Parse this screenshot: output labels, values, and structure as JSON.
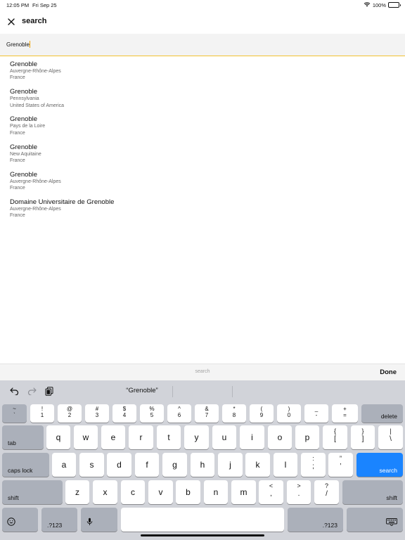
{
  "status_bar": {
    "time": "12:05 PM",
    "date": "Fri Sep 25",
    "battery": "100%"
  },
  "nav": {
    "title": "search"
  },
  "search": {
    "value": "Grenoble"
  },
  "results": [
    {
      "name": "Grenoble",
      "region": "Auvergne-Rhône-Alpes",
      "country": "France"
    },
    {
      "name": "Grenoble",
      "region": "Pennsylvania",
      "country": "United States of America"
    },
    {
      "name": "Grenoble",
      "region": "Pays de la Loire",
      "country": "France"
    },
    {
      "name": "Grenoble",
      "region": "New Aquitaine",
      "country": "France"
    },
    {
      "name": "Grenoble",
      "region": "Auvergne-Rhône-Alpes",
      "country": "France"
    },
    {
      "name": "Domaine Universitaire de Grenoble",
      "region": "Auvergne-Rhône-Alpes",
      "country": "France"
    }
  ],
  "accessory": {
    "label": "search",
    "done": "Done"
  },
  "keyboard": {
    "suggestion": "“Grenoble”",
    "number_row": [
      {
        "top": "~",
        "bottom": "`"
      },
      {
        "top": "!",
        "bottom": "1"
      },
      {
        "top": "@",
        "bottom": "2"
      },
      {
        "top": "#",
        "bottom": "3"
      },
      {
        "top": "$",
        "bottom": "4"
      },
      {
        "top": "%",
        "bottom": "5"
      },
      {
        "top": "^",
        "bottom": "6"
      },
      {
        "top": "&",
        "bottom": "7"
      },
      {
        "top": "*",
        "bottom": "8"
      },
      {
        "top": "(",
        "bottom": "9"
      },
      {
        "top": ")",
        "bottom": "0"
      },
      {
        "top": "_",
        "bottom": "-"
      },
      {
        "top": "+",
        "bottom": "="
      }
    ],
    "delete": "delete",
    "tab": "tab",
    "row_q": [
      "q",
      "w",
      "e",
      "r",
      "t",
      "y",
      "u",
      "i",
      "o",
      "p"
    ],
    "row_q_symbols": [
      {
        "top": "{",
        "bottom": "["
      },
      {
        "top": "}",
        "bottom": "]"
      },
      {
        "top": "|",
        "bottom": "\\"
      }
    ],
    "caps_lock": "caps lock",
    "row_a": [
      "a",
      "s",
      "d",
      "f",
      "g",
      "h",
      "j",
      "k",
      "l"
    ],
    "row_a_symbols": [
      {
        "top": ":",
        "bottom": ";"
      },
      {
        "top": "”",
        "bottom": "’"
      }
    ],
    "search": "search",
    "shift": "shift",
    "row_z": [
      "z",
      "x",
      "c",
      "v",
      "b",
      "n",
      "m"
    ],
    "row_z_symbols": [
      {
        "top": "<",
        "bottom": ","
      },
      {
        "top": ">",
        "bottom": "."
      },
      {
        "top": "?",
        "bottom": "/"
      }
    ],
    "numbers": ".?123"
  },
  "colors": {
    "accent": "#f2c230",
    "key_blue": "#1a84ff",
    "keyboard_bg": "#d1d3d9"
  }
}
